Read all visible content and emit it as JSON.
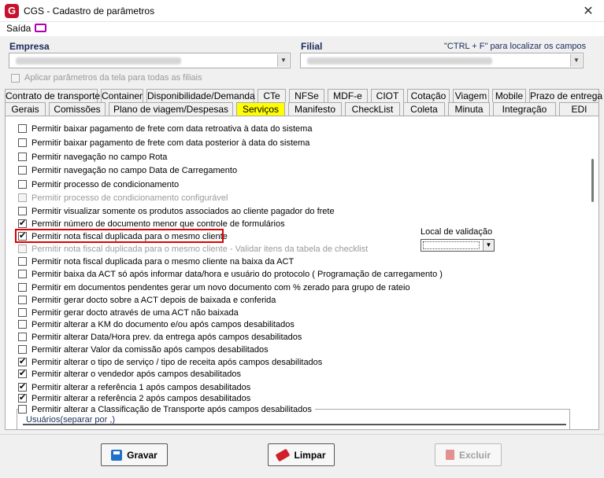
{
  "window": {
    "title": "CGS - Cadastro de parâmetros",
    "logo_letter": "G"
  },
  "menu": {
    "saida": "Saída"
  },
  "empresa": {
    "label": "Empresa"
  },
  "filial": {
    "label": "Filial"
  },
  "hint": "\"CTRL + F\" para localizar os campos",
  "apply_all": "Aplicar parâmetros da tela para todas as filiais",
  "tabs_row1": [
    "Contrato de transporte",
    "Container",
    "Disponibilidade/Demanda",
    "CTe",
    "NFSe",
    "MDF-e",
    "CIOT",
    "Cotação",
    "Viagem",
    "Mobile",
    "Prazo de entrega"
  ],
  "tabs_row2": [
    "Gerais",
    "Comissões",
    "Plano de viagem/Despesas",
    "Serviços",
    "Manifesto",
    "CheckList",
    "Coleta",
    "Minuta",
    "Integração",
    "EDI"
  ],
  "active_tab": "Serviços",
  "options": [
    {
      "label": "Permitir baixar pagamento de frete com data retroativa à data do sistema",
      "checked": false,
      "disabled": false
    },
    {
      "label": "Permitir baixar pagamento de frete com data posterior à data do sistema",
      "checked": false,
      "disabled": false
    },
    {
      "label": "Permitir navegação no campo Rota",
      "checked": false,
      "disabled": false
    },
    {
      "label": "Permitir navegação no campo Data de Carregamento",
      "checked": false,
      "disabled": false
    },
    {
      "label": "Permitir processo de condicionamento",
      "checked": false,
      "disabled": false
    },
    {
      "label": "Permitir processo de condicionamento configurável",
      "checked": false,
      "disabled": true
    },
    {
      "label": "Permitir visualizar somente os produtos associados ao cliente pagador do frete",
      "checked": false,
      "disabled": false
    },
    {
      "label": "Permitir número de documento menor que controle de formulários",
      "checked": true,
      "disabled": false
    },
    {
      "label": "Permitir nota fiscal duplicada para o mesmo cliente",
      "checked": true,
      "disabled": false
    },
    {
      "label": "Permitir nota fiscal duplicada para o mesmo cliente - Validar itens da tabela de checklist",
      "checked": false,
      "disabled": true
    },
    {
      "label": "Permitir nota fiscal duplicada para o mesmo cliente na baixa da ACT",
      "checked": false,
      "disabled": false
    },
    {
      "label": "Permitir baixa da ACT só após informar data/hora e usuário do protocolo ( Programação de carregamento )",
      "checked": false,
      "disabled": false
    },
    {
      "label": "Permitir em documentos pendentes gerar um novo documento com % zerado para grupo de rateio",
      "checked": false,
      "disabled": false
    },
    {
      "label": "Permitir gerar docto sobre a ACT depois de baixada e conferida",
      "checked": false,
      "disabled": false
    },
    {
      "label": "Permitir gerar docto através de uma ACT não baixada",
      "checked": false,
      "disabled": false
    },
    {
      "label": "Permitir alterar a KM do documento e/ou após campos desabilitados",
      "checked": false,
      "disabled": false
    },
    {
      "label": "Permitir alterar Data/Hora prev. da entrega após campos desabilitados",
      "checked": false,
      "disabled": false
    },
    {
      "label": "Permitir alterar Valor da comissão após campos desabilitados",
      "checked": false,
      "disabled": false
    },
    {
      "label": "Permitir alterar o tipo de serviço / tipo de receita após campos desabilitados",
      "checked": true,
      "disabled": false
    },
    {
      "label": "Permitir alterar o vendedor após campos desabilitados",
      "checked": true,
      "disabled": false
    },
    {
      "label": "Permitir alterar a referência 1 após campos desabilitados",
      "checked": true,
      "disabled": false
    },
    {
      "label": "Permitir alterar a referência 2 após campos desabilitados",
      "checked": true,
      "disabled": false
    },
    {
      "label": "Permitir alterar a Classificação de Transporte após campos desabilitados",
      "checked": false,
      "disabled": false
    }
  ],
  "local_validacao": {
    "label": "Local de validação"
  },
  "usuarios_label": "Usuários(separar por ,)",
  "buttons": {
    "gravar": "Gravar",
    "limpar": "Limpar",
    "excluir": "Excluir"
  }
}
